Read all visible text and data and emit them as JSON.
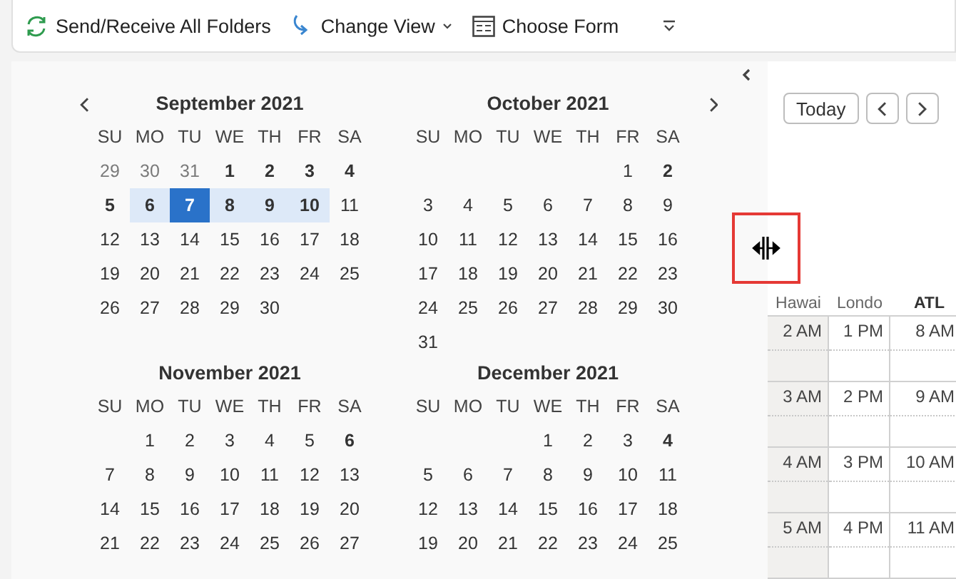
{
  "toolbar": {
    "items": [
      {
        "kind": "sync",
        "label": "Send/Receive All Folders",
        "caret": false
      },
      {
        "kind": "view",
        "label": "Change View",
        "caret": true
      },
      {
        "kind": "form",
        "label": "Choose Form",
        "caret": false
      },
      {
        "kind": "overflow"
      }
    ]
  },
  "navigator": {
    "months": [
      {
        "title": "September 2021",
        "prev_arrow": true,
        "next_arrow": false,
        "weekdays": [
          "SU",
          "MO",
          "TU",
          "WE",
          "TH",
          "FR",
          "SA"
        ],
        "weeks": [
          {
            "work_week_highlighted": false,
            "days": [
              {
                "kind": "other",
                "label": "29",
                "bold": false,
                "selected": false
              },
              {
                "kind": "other",
                "label": "30",
                "bold": false,
                "selected": false
              },
              {
                "kind": "other",
                "label": "31",
                "bold": false,
                "selected": false
              },
              {
                "kind": "day",
                "label": "1",
                "bold": true,
                "selected": false
              },
              {
                "kind": "day",
                "label": "2",
                "bold": true,
                "selected": false
              },
              {
                "kind": "day",
                "label": "3",
                "bold": true,
                "selected": false
              },
              {
                "kind": "day",
                "label": "4",
                "bold": true,
                "selected": false
              }
            ]
          },
          {
            "work_week_highlighted": true,
            "days": [
              {
                "kind": "day",
                "label": "5",
                "bold": true,
                "selected": false
              },
              {
                "kind": "day",
                "label": "6",
                "bold": true,
                "selected": false
              },
              {
                "kind": "day",
                "label": "7",
                "bold": true,
                "selected": true
              },
              {
                "kind": "day",
                "label": "8",
                "bold": true,
                "selected": false
              },
              {
                "kind": "day",
                "label": "9",
                "bold": true,
                "selected": false
              },
              {
                "kind": "day",
                "label": "10",
                "bold": true,
                "selected": false
              },
              {
                "kind": "day",
                "label": "11",
                "bold": false,
                "selected": false
              }
            ]
          },
          {
            "work_week_highlighted": false,
            "days": [
              {
                "kind": "day",
                "label": "12",
                "bold": false,
                "selected": false
              },
              {
                "kind": "day",
                "label": "13",
                "bold": false,
                "selected": false
              },
              {
                "kind": "day",
                "label": "14",
                "bold": false,
                "selected": false
              },
              {
                "kind": "day",
                "label": "15",
                "bold": false,
                "selected": false
              },
              {
                "kind": "day",
                "label": "16",
                "bold": false,
                "selected": false
              },
              {
                "kind": "day",
                "label": "17",
                "bold": false,
                "selected": false
              },
              {
                "kind": "day",
                "label": "18",
                "bold": false,
                "selected": false
              }
            ]
          },
          {
            "work_week_highlighted": false,
            "days": [
              {
                "kind": "day",
                "label": "19",
                "bold": false,
                "selected": false
              },
              {
                "kind": "day",
                "label": "20",
                "bold": false,
                "selected": false
              },
              {
                "kind": "day",
                "label": "21",
                "bold": false,
                "selected": false
              },
              {
                "kind": "day",
                "label": "22",
                "bold": false,
                "selected": false
              },
              {
                "kind": "day",
                "label": "23",
                "bold": false,
                "selected": false
              },
              {
                "kind": "day",
                "label": "24",
                "bold": false,
                "selected": false
              },
              {
                "kind": "day",
                "label": "25",
                "bold": false,
                "selected": false
              }
            ]
          },
          {
            "work_week_highlighted": false,
            "days": [
              {
                "kind": "day",
                "label": "26",
                "bold": false,
                "selected": false
              },
              {
                "kind": "day",
                "label": "27",
                "bold": false,
                "selected": false
              },
              {
                "kind": "day",
                "label": "28",
                "bold": false,
                "selected": false
              },
              {
                "kind": "day",
                "label": "29",
                "bold": false,
                "selected": false
              },
              {
                "kind": "day",
                "label": "30",
                "bold": false,
                "selected": false
              }
            ]
          }
        ]
      },
      {
        "title": "October 2021",
        "prev_arrow": false,
        "next_arrow": true,
        "weekdays": [
          "SU",
          "MO",
          "TU",
          "WE",
          "TH",
          "FR",
          "SA"
        ],
        "weeks": [
          {
            "work_week_highlighted": false,
            "days": [
              {
                "kind": "blank"
              },
              {
                "kind": "blank"
              },
              {
                "kind": "blank"
              },
              {
                "kind": "blank"
              },
              {
                "kind": "blank"
              },
              {
                "kind": "day",
                "label": "1",
                "bold": false,
                "selected": false
              },
              {
                "kind": "day",
                "label": "2",
                "bold": true,
                "selected": false
              }
            ]
          },
          {
            "work_week_highlighted": false,
            "days": [
              {
                "kind": "day",
                "label": "3",
                "bold": false,
                "selected": false
              },
              {
                "kind": "day",
                "label": "4",
                "bold": false,
                "selected": false
              },
              {
                "kind": "day",
                "label": "5",
                "bold": false,
                "selected": false
              },
              {
                "kind": "day",
                "label": "6",
                "bold": false,
                "selected": false
              },
              {
                "kind": "day",
                "label": "7",
                "bold": false,
                "selected": false
              },
              {
                "kind": "day",
                "label": "8",
                "bold": false,
                "selected": false
              },
              {
                "kind": "day",
                "label": "9",
                "bold": false,
                "selected": false
              }
            ]
          },
          {
            "work_week_highlighted": false,
            "days": [
              {
                "kind": "day",
                "label": "10",
                "bold": false,
                "selected": false
              },
              {
                "kind": "day",
                "label": "11",
                "bold": false,
                "selected": false
              },
              {
                "kind": "day",
                "label": "12",
                "bold": false,
                "selected": false
              },
              {
                "kind": "day",
                "label": "13",
                "bold": false,
                "selected": false
              },
              {
                "kind": "day",
                "label": "14",
                "bold": false,
                "selected": false
              },
              {
                "kind": "day",
                "label": "15",
                "bold": false,
                "selected": false
              },
              {
                "kind": "day",
                "label": "16",
                "bold": false,
                "selected": false
              }
            ]
          },
          {
            "work_week_highlighted": false,
            "days": [
              {
                "kind": "day",
                "label": "17",
                "bold": false,
                "selected": false
              },
              {
                "kind": "day",
                "label": "18",
                "bold": false,
                "selected": false
              },
              {
                "kind": "day",
                "label": "19",
                "bold": false,
                "selected": false
              },
              {
                "kind": "day",
                "label": "20",
                "bold": false,
                "selected": false
              },
              {
                "kind": "day",
                "label": "21",
                "bold": false,
                "selected": false
              },
              {
                "kind": "day",
                "label": "22",
                "bold": false,
                "selected": false
              },
              {
                "kind": "day",
                "label": "23",
                "bold": false,
                "selected": false
              }
            ]
          },
          {
            "work_week_highlighted": false,
            "days": [
              {
                "kind": "day",
                "label": "24",
                "bold": false,
                "selected": false
              },
              {
                "kind": "day",
                "label": "25",
                "bold": false,
                "selected": false
              },
              {
                "kind": "day",
                "label": "26",
                "bold": false,
                "selected": false
              },
              {
                "kind": "day",
                "label": "27",
                "bold": false,
                "selected": false
              },
              {
                "kind": "day",
                "label": "28",
                "bold": false,
                "selected": false
              },
              {
                "kind": "day",
                "label": "29",
                "bold": false,
                "selected": false
              },
              {
                "kind": "day",
                "label": "30",
                "bold": false,
                "selected": false
              }
            ]
          },
          {
            "work_week_highlighted": false,
            "days": [
              {
                "kind": "day",
                "label": "31",
                "bold": false,
                "selected": false
              }
            ]
          }
        ]
      },
      {
        "title": "November 2021",
        "prev_arrow": false,
        "next_arrow": false,
        "weekdays": [
          "SU",
          "MO",
          "TU",
          "WE",
          "TH",
          "FR",
          "SA"
        ],
        "weeks": [
          {
            "work_week_highlighted": false,
            "days": [
              {
                "kind": "blank"
              },
              {
                "kind": "day",
                "label": "1",
                "bold": false,
                "selected": false
              },
              {
                "kind": "day",
                "label": "2",
                "bold": false,
                "selected": false
              },
              {
                "kind": "day",
                "label": "3",
                "bold": false,
                "selected": false
              },
              {
                "kind": "day",
                "label": "4",
                "bold": false,
                "selected": false
              },
              {
                "kind": "day",
                "label": "5",
                "bold": false,
                "selected": false
              },
              {
                "kind": "day",
                "label": "6",
                "bold": true,
                "selected": false
              }
            ]
          },
          {
            "work_week_highlighted": false,
            "days": [
              {
                "kind": "day",
                "label": "7",
                "bold": false,
                "selected": false
              },
              {
                "kind": "day",
                "label": "8",
                "bold": false,
                "selected": false
              },
              {
                "kind": "day",
                "label": "9",
                "bold": false,
                "selected": false
              },
              {
                "kind": "day",
                "label": "10",
                "bold": false,
                "selected": false
              },
              {
                "kind": "day",
                "label": "11",
                "bold": false,
                "selected": false
              },
              {
                "kind": "day",
                "label": "12",
                "bold": false,
                "selected": false
              },
              {
                "kind": "day",
                "label": "13",
                "bold": false,
                "selected": false
              }
            ]
          },
          {
            "work_week_highlighted": false,
            "days": [
              {
                "kind": "day",
                "label": "14",
                "bold": false,
                "selected": false
              },
              {
                "kind": "day",
                "label": "15",
                "bold": false,
                "selected": false
              },
              {
                "kind": "day",
                "label": "16",
                "bold": false,
                "selected": false
              },
              {
                "kind": "day",
                "label": "17",
                "bold": false,
                "selected": false
              },
              {
                "kind": "day",
                "label": "18",
                "bold": false,
                "selected": false
              },
              {
                "kind": "day",
                "label": "19",
                "bold": false,
                "selected": false
              },
              {
                "kind": "day",
                "label": "20",
                "bold": false,
                "selected": false
              }
            ]
          },
          {
            "work_week_highlighted": false,
            "days": [
              {
                "kind": "day",
                "label": "21",
                "bold": false,
                "selected": false
              },
              {
                "kind": "day",
                "label": "22",
                "bold": false,
                "selected": false
              },
              {
                "kind": "day",
                "label": "23",
                "bold": false,
                "selected": false
              },
              {
                "kind": "day",
                "label": "24",
                "bold": false,
                "selected": false
              },
              {
                "kind": "day",
                "label": "25",
                "bold": false,
                "selected": false
              },
              {
                "kind": "day",
                "label": "26",
                "bold": false,
                "selected": false
              },
              {
                "kind": "day",
                "label": "27",
                "bold": false,
                "selected": false
              }
            ]
          }
        ]
      },
      {
        "title": "December 2021",
        "prev_arrow": false,
        "next_arrow": false,
        "weekdays": [
          "SU",
          "MO",
          "TU",
          "WE",
          "TH",
          "FR",
          "SA"
        ],
        "weeks": [
          {
            "work_week_highlighted": false,
            "days": [
              {
                "kind": "blank"
              },
              {
                "kind": "blank"
              },
              {
                "kind": "blank"
              },
              {
                "kind": "day",
                "label": "1",
                "bold": false,
                "selected": false
              },
              {
                "kind": "day",
                "label": "2",
                "bold": false,
                "selected": false
              },
              {
                "kind": "day",
                "label": "3",
                "bold": false,
                "selected": false
              },
              {
                "kind": "day",
                "label": "4",
                "bold": true,
                "selected": false
              }
            ]
          },
          {
            "work_week_highlighted": false,
            "days": [
              {
                "kind": "day",
                "label": "5",
                "bold": false,
                "selected": false
              },
              {
                "kind": "day",
                "label": "6",
                "bold": false,
                "selected": false
              },
              {
                "kind": "day",
                "label": "7",
                "bold": false,
                "selected": false
              },
              {
                "kind": "day",
                "label": "8",
                "bold": false,
                "selected": false
              },
              {
                "kind": "day",
                "label": "9",
                "bold": false,
                "selected": false
              },
              {
                "kind": "day",
                "label": "10",
                "bold": false,
                "selected": false
              },
              {
                "kind": "day",
                "label": "11",
                "bold": false,
                "selected": false
              }
            ]
          },
          {
            "work_week_highlighted": false,
            "days": [
              {
                "kind": "day",
                "label": "12",
                "bold": false,
                "selected": false
              },
              {
                "kind": "day",
                "label": "13",
                "bold": false,
                "selected": false
              },
              {
                "kind": "day",
                "label": "14",
                "bold": false,
                "selected": false
              },
              {
                "kind": "day",
                "label": "15",
                "bold": false,
                "selected": false
              },
              {
                "kind": "day",
                "label": "16",
                "bold": false,
                "selected": false
              },
              {
                "kind": "day",
                "label": "17",
                "bold": false,
                "selected": false
              },
              {
                "kind": "day",
                "label": "18",
                "bold": false,
                "selected": false
              }
            ]
          },
          {
            "work_week_highlighted": false,
            "days": [
              {
                "kind": "day",
                "label": "19",
                "bold": false,
                "selected": false
              },
              {
                "kind": "day",
                "label": "20",
                "bold": false,
                "selected": false
              },
              {
                "kind": "day",
                "label": "21",
                "bold": false,
                "selected": false
              },
              {
                "kind": "day",
                "label": "22",
                "bold": false,
                "selected": false
              },
              {
                "kind": "day",
                "label": "23",
                "bold": false,
                "selected": false
              },
              {
                "kind": "day",
                "label": "24",
                "bold": false,
                "selected": false
              },
              {
                "kind": "day",
                "label": "25",
                "bold": false,
                "selected": false
              }
            ]
          }
        ]
      }
    ]
  },
  "calendar": {
    "today_button": "Today",
    "time_zones": [
      {
        "label": "Hawai",
        "primary": false
      },
      {
        "label": "Londo",
        "primary": false
      },
      {
        "label": "ATL",
        "primary": true
      }
    ],
    "rows": [
      {
        "times": [
          "2 AM",
          "1 PM",
          "8 AM"
        ]
      },
      {
        "times": [
          "3 AM",
          "2 PM",
          "9 AM"
        ]
      },
      {
        "times": [
          "4 AM",
          "3 PM",
          "10 AM"
        ]
      },
      {
        "times": [
          "5 AM",
          "4 PM",
          "11 AM"
        ]
      }
    ]
  }
}
